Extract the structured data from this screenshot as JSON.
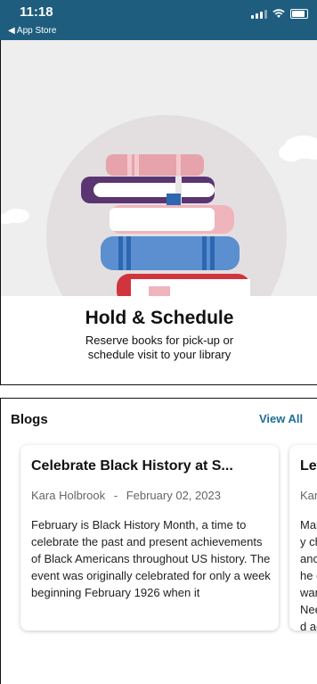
{
  "status": {
    "time": "11:18",
    "back": "◀ App Store"
  },
  "hero": {
    "title": "Hold & Schedule",
    "subtitle": "Reserve books for pick-up or schedule visit to your library"
  },
  "blogs": {
    "heading": "Blogs",
    "view_all": "View All",
    "cards": [
      {
        "title": "Celebrate Black History at S...",
        "author": "Kara Holbrook",
        "separator": "-",
        "date": "February 02, 2023",
        "excerpt": "February is Black History Month, a time to celebrate the past and present achievements of Black Americans throughout US history. The event was originally celebrated for only a week beginning February 1926 when it"
      },
      {
        "title": "Let S",
        "author": "Kara",
        "separator": "",
        "date": "",
        "excerpt": "Many chanc the c want Need ace y"
      }
    ]
  },
  "colors": {
    "status_bar": "#1f5d7e",
    "link": "#1f6e93"
  }
}
